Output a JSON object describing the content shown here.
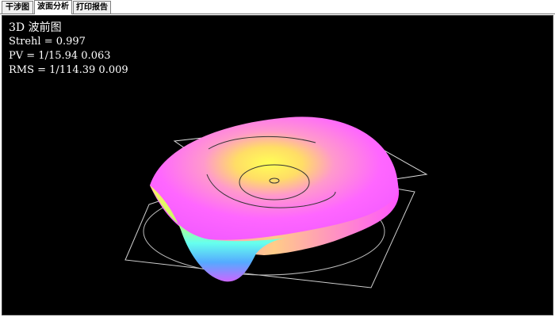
{
  "tabs": [
    {
      "label": "干涉图",
      "active": false
    },
    {
      "label": "波面分析",
      "active": true
    },
    {
      "label": "打印报告",
      "active": false
    }
  ],
  "info": {
    "title": "3D 波前图",
    "strehl": "Strehl = 0.997",
    "pv": "PV = 1/15.94   0.063",
    "rms": "RMS = 1/114.39   0.009"
  },
  "colors": {
    "background": "#000000",
    "text": "#ffffff",
    "surface_gradient": [
      "#ff66ff",
      "#ff88cc",
      "#ffcc66",
      "#ffff66",
      "#ccff66",
      "#66ffff",
      "#4488ff"
    ]
  }
}
